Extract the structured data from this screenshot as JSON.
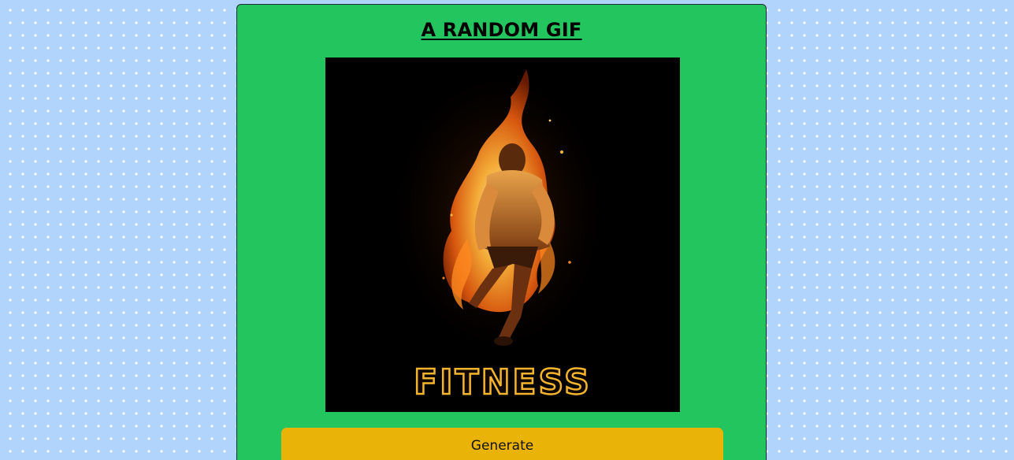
{
  "header": {
    "title": "A RANDOM GIF"
  },
  "gif": {
    "caption": "FITNESS",
    "subject": "runner-on-fire-illustration",
    "background_color": "#000000"
  },
  "actions": {
    "generate_label": "Generate"
  },
  "colors": {
    "page_background": "#b1d4fc",
    "card_background": "#22c55e",
    "button_background": "#eab308"
  }
}
